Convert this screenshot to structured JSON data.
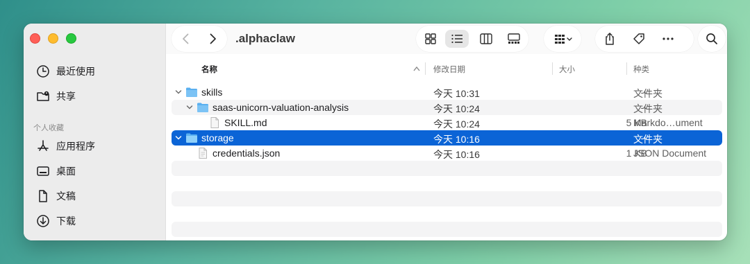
{
  "window": {
    "title": ".alphaclaw"
  },
  "sidebar": {
    "top_items": [
      {
        "label": "最近使用",
        "icon": "clock-icon"
      },
      {
        "label": "共享",
        "icon": "shared-folder-icon"
      }
    ],
    "section_title": "个人收藏",
    "favorites": [
      {
        "label": "应用程序",
        "icon": "applications-icon"
      },
      {
        "label": "桌面",
        "icon": "desktop-icon"
      },
      {
        "label": "文稿",
        "icon": "document-icon"
      },
      {
        "label": "下载",
        "icon": "download-icon"
      }
    ]
  },
  "toolbar": {
    "icons": [
      "back-icon",
      "forward-icon",
      "icon-view",
      "list-view",
      "column-view",
      "gallery-view",
      "group-icon",
      "share-icon",
      "tag-icon",
      "more-icon",
      "search-icon"
    ]
  },
  "columns": {
    "name": "名称",
    "date": "修改日期",
    "size": "大小",
    "kind": "种类"
  },
  "rows": [
    {
      "name": "skills",
      "date": "今天 10:31",
      "size": "--",
      "kind": "文件夹",
      "type": "folder",
      "expanded": true
    },
    {
      "name": "saas-unicorn-valuation-analysis",
      "date": "今天 10:24",
      "size": "--",
      "kind": "文件夹",
      "type": "folder",
      "expanded": true
    },
    {
      "name": "SKILL.md",
      "date": "今天 10:24",
      "size": "5 KB",
      "kind": "Markdo…ument",
      "type": "file"
    },
    {
      "name": "storage",
      "date": "今天 10:16",
      "size": "--",
      "kind": "文件夹",
      "type": "folder",
      "expanded": true,
      "selected": true
    },
    {
      "name": "credentials.json",
      "date": "今天 10:16",
      "size": "1 KB",
      "kind": "JSON Document",
      "type": "file"
    }
  ],
  "colors": {
    "selection": "#0b64d6",
    "folder": "#5ab0f0"
  }
}
